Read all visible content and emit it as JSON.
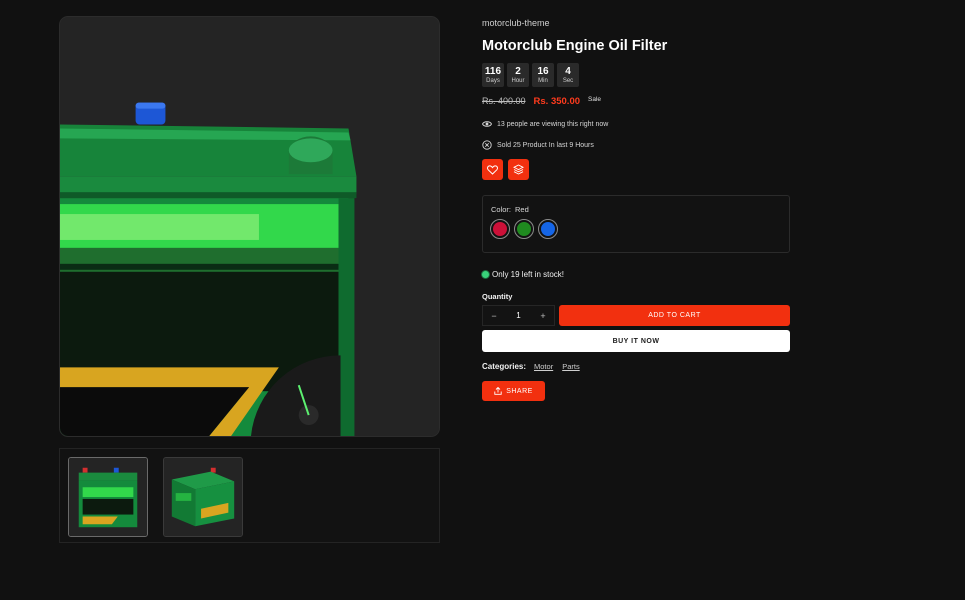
{
  "gallery": {
    "main_image": "battery-front-view",
    "thumbnails": [
      "battery-front-view",
      "battery-angled-view"
    ]
  },
  "product": {
    "vendor": "motorclub-theme",
    "title": "Motorclub Engine Oil Filter",
    "countdown": [
      {
        "value": "116",
        "label": "Days"
      },
      {
        "value": "2",
        "label": "Hour"
      },
      {
        "value": "16",
        "label": "Min"
      },
      {
        "value": "4",
        "label": "Sec"
      }
    ],
    "price_old": "Rs. 400.00",
    "price_new": "Rs. 350.00",
    "badge": "Sale",
    "viewers_text": "13 people are viewing this right now",
    "sold_text": "Sold 25 Product In last 9 Hours",
    "color_label": "Color:",
    "color_value": "Red",
    "swatches": [
      {
        "name": "Red",
        "hex": "#cc1038"
      },
      {
        "name": "Green",
        "hex": "#1f8a1f"
      },
      {
        "name": "Blue",
        "hex": "#1565e6"
      }
    ],
    "stock_text": "Only 19 left in stock!",
    "quantity_label": "Quantity",
    "quantity_value": "1",
    "qty_minus": "−",
    "qty_plus": "+",
    "add_to_cart_label": "ADD TO CART",
    "buy_now_label": "BUY IT NOW",
    "categories_label": "Categories:",
    "categories": [
      "Motor",
      "Parts"
    ],
    "share_label": "SHARE"
  },
  "colors": {
    "accent": "#f2300f",
    "background": "#111111",
    "in_stock": "#39d17a"
  }
}
